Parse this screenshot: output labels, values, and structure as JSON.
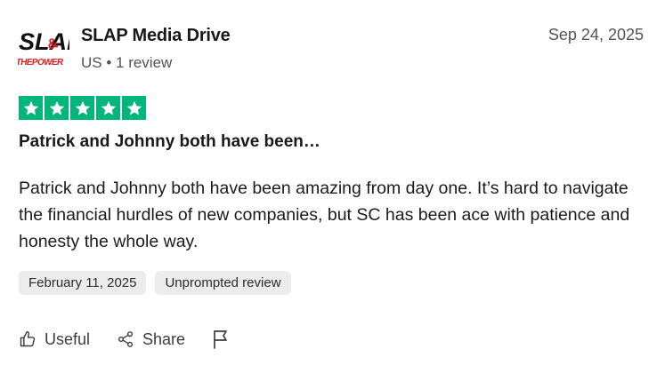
{
  "reviewer": {
    "avatar_text_top": "SLAP",
    "avatar_text_bottom": "THEPOWER",
    "name": "SLAP Media Drive",
    "meta": "US • 1 review"
  },
  "review": {
    "date": "Sep 24, 2025",
    "rating": 5,
    "title": "Patrick and Johnny both have been…",
    "body": "Patrick and Johnny both have been amazing from day one. It’s hard to navigate the financial hurdles of new companies, but SC has been ace with patience and honesty the whole way.",
    "tags": [
      "February 11, 2025",
      "Unprompted review"
    ]
  },
  "actions": {
    "useful_label": "Useful",
    "share_label": "Share"
  },
  "icons": {
    "star": "star-icon",
    "useful": "thumbs-up-icon",
    "share": "share-icon",
    "report": "flag-icon"
  },
  "colors": {
    "star_green": "#00b67a",
    "avatar_red": "#e01b1b",
    "avatar_dark": "#111111"
  }
}
